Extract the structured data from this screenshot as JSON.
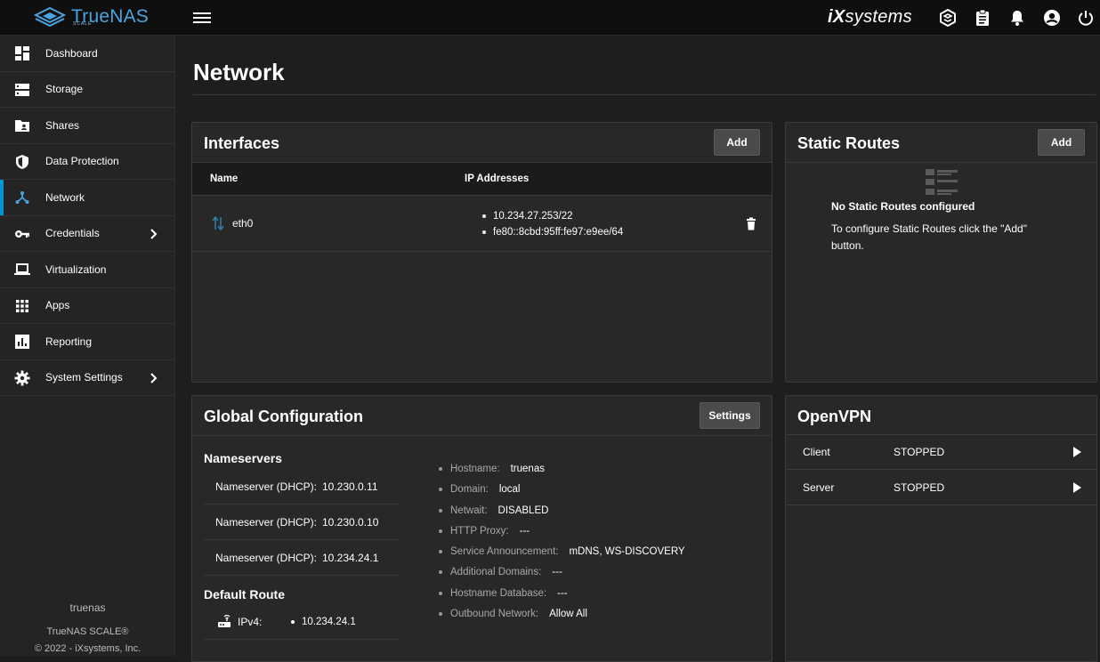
{
  "brand": {
    "name": "TrueNAS",
    "sub": "SCALE",
    "vendor_a": "iX",
    "vendor_b": "systems"
  },
  "sidebar": {
    "items": [
      {
        "label": "Dashboard",
        "icon": "dashboard-icon"
      },
      {
        "label": "Storage",
        "icon": "storage-icon"
      },
      {
        "label": "Shares",
        "icon": "shares-folder-icon"
      },
      {
        "label": "Data Protection",
        "icon": "shield-icon"
      },
      {
        "label": "Network",
        "icon": "network-icon",
        "active": true
      },
      {
        "label": "Credentials",
        "icon": "key-icon",
        "has_children": true
      },
      {
        "label": "Virtualization",
        "icon": "laptop-icon"
      },
      {
        "label": "Apps",
        "icon": "apps-grid-icon"
      },
      {
        "label": "Reporting",
        "icon": "reporting-chart-icon"
      },
      {
        "label": "System Settings",
        "icon": "gear-icon",
        "has_children": true
      }
    ],
    "footer": {
      "hostname": "truenas",
      "product": "TrueNAS SCALE®",
      "copyright": "© 2022 - iXsystems, Inc."
    }
  },
  "page": {
    "title": "Network"
  },
  "interfaces": {
    "title": "Interfaces",
    "add_label": "Add",
    "columns": [
      "Name",
      "IP Addresses"
    ],
    "rows": [
      {
        "name": "eth0",
        "ips": [
          "10.234.27.253/22",
          "fe80::8cbd:95ff:fe97:e9ee/64"
        ]
      }
    ]
  },
  "static_routes": {
    "title": "Static Routes",
    "add_label": "Add",
    "empty_title": "No Static Routes configured",
    "empty_line1": "To configure Static Routes click the \"Add\"",
    "empty_line2": "button."
  },
  "global_config": {
    "title": "Global Configuration",
    "settings_label": "Settings",
    "nameservers_title": "Nameservers",
    "nameservers": [
      {
        "label": "Nameserver (DHCP):",
        "value": "10.230.0.11"
      },
      {
        "label": "Nameserver (DHCP):",
        "value": "10.230.0.10"
      },
      {
        "label": "Nameserver (DHCP):",
        "value": "10.234.24.1"
      }
    ],
    "default_route_title": "Default Route",
    "default_route": {
      "label": "IPv4:",
      "value": "10.234.24.1"
    },
    "details": [
      {
        "label": "Hostname:",
        "value": "truenas"
      },
      {
        "label": "Domain:",
        "value": "local"
      },
      {
        "label": "Netwait:",
        "value": "DISABLED"
      },
      {
        "label": "HTTP Proxy:",
        "value": "---"
      },
      {
        "label": "Service Announcement:",
        "value": "mDNS, WS-DISCOVERY"
      },
      {
        "label": "Additional Domains:",
        "value": "---"
      },
      {
        "label": "Hostname Database:",
        "value": "---"
      },
      {
        "label": "Outbound Network:",
        "value": "Allow All"
      }
    ]
  },
  "openvpn": {
    "title": "OpenVPN",
    "rows": [
      {
        "name": "Client",
        "status": "STOPPED"
      },
      {
        "name": "Server",
        "status": "STOPPED"
      }
    ]
  },
  "colors": {
    "accent": "#0095d5",
    "brand": "#4aa3df",
    "background": "#1e1e1e",
    "card": "#282828"
  }
}
